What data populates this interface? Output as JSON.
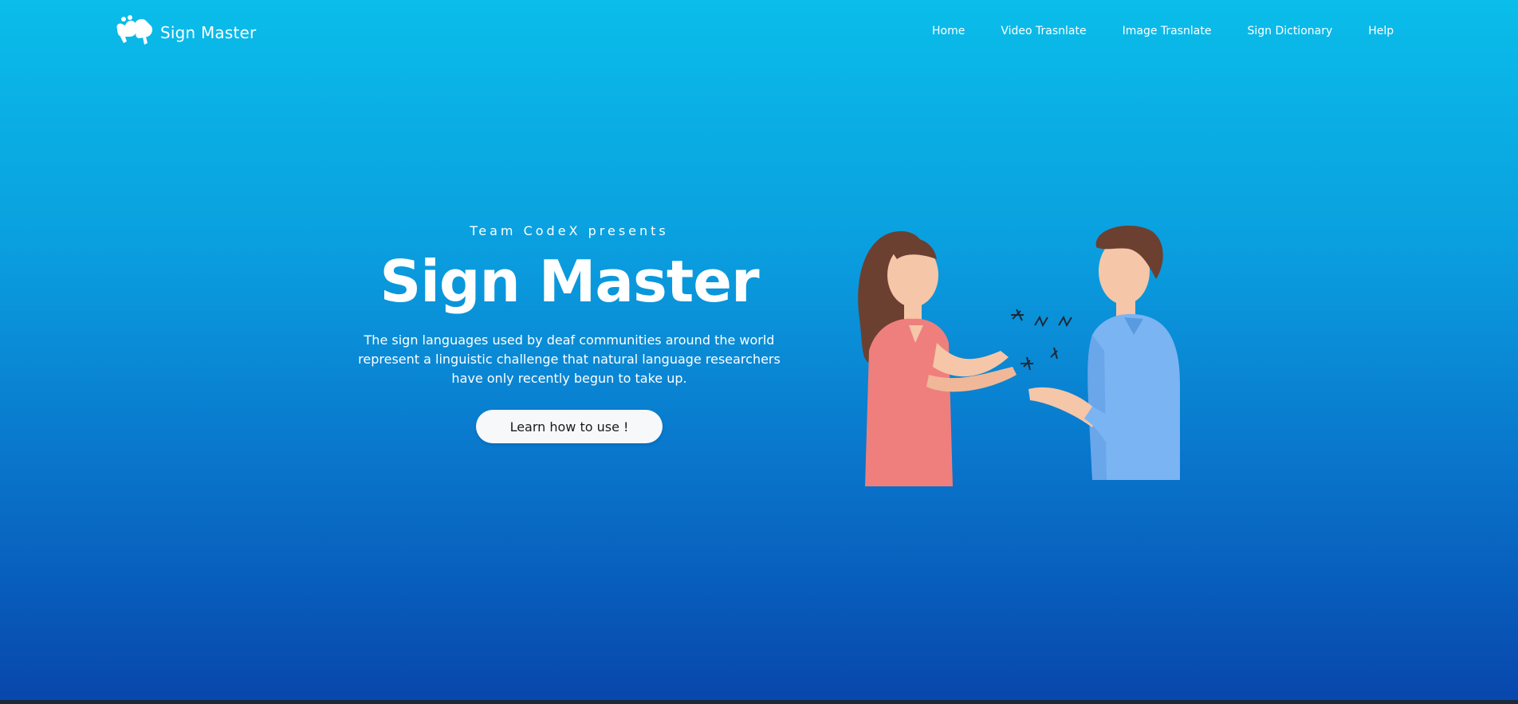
{
  "brand": {
    "name": "Sign Master",
    "logo_icon": "signing-hands-icon"
  },
  "nav": {
    "items": [
      {
        "label": "Home"
      },
      {
        "label": "Video Trasnlate"
      },
      {
        "label": "Image Trasnlate"
      },
      {
        "label": "Sign Dictionary"
      },
      {
        "label": "Help"
      }
    ]
  },
  "hero": {
    "presents": "Team CodeX presents",
    "title": "Sign Master",
    "description": "The sign languages used by deaf communities around the world represent a linguistic challenge that natural language researchers have only recently begun to take up.",
    "cta_label": "Learn how to use !"
  },
  "colors": {
    "gradient_top": "#0abdea",
    "gradient_bottom": "#0846ac",
    "button_bg": "#f7f8fa"
  }
}
